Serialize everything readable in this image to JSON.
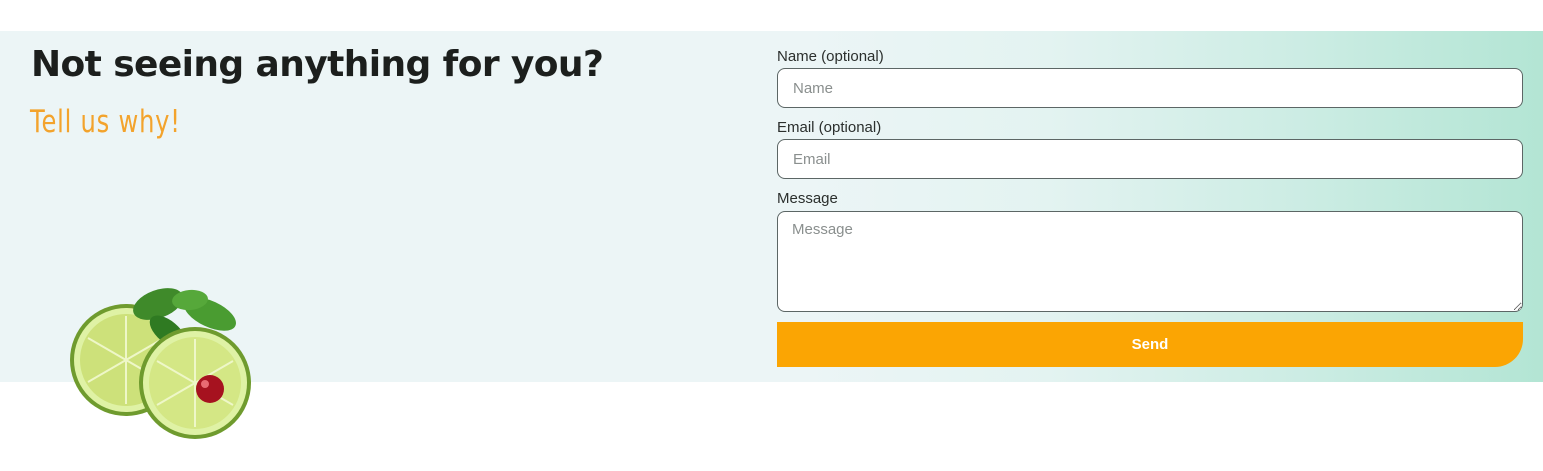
{
  "section": {
    "heading": "Not seeing anything for you?",
    "subheading": "Tell us why!",
    "decoration_icon": "lime-slices-with-mint-and-cranberry"
  },
  "form": {
    "name_label": "Name (optional)",
    "name_placeholder": "Name",
    "name_value": "",
    "email_label": "Email (optional)",
    "email_placeholder": "Email",
    "email_value": "",
    "message_label": "Message",
    "message_placeholder": "Message",
    "message_value": "",
    "send_label": "Send"
  },
  "colors": {
    "accent": "#fba503",
    "subheading": "#f3a32c",
    "heading": "#1c1f1d",
    "band_left": "#ecf5f6",
    "band_right": "#b3e5d4"
  }
}
